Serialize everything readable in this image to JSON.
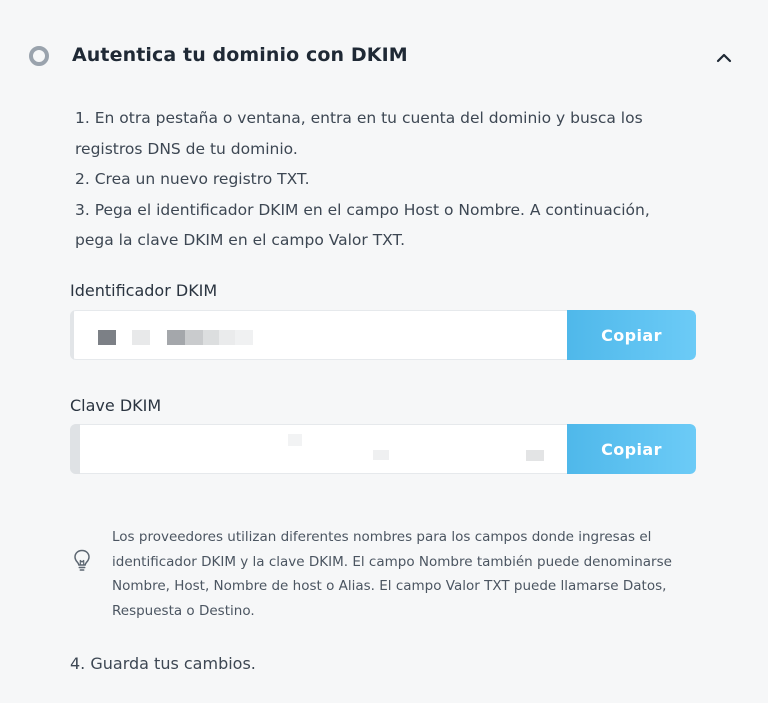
{
  "header": {
    "title": "Autentica tu dominio con DKIM"
  },
  "instructions": [
    "1. En otra pestaña o ventana, entra en tu cuenta del dominio y busca los",
    "registros DNS de tu dominio.",
    "2. Crea un nuevo registro TXT.",
    "3. Pega el identificador DKIM en el campo Host o Nombre. A continuación,",
    "pega la clave DKIM en el campo Valor TXT."
  ],
  "dkim_identifier": {
    "label": "Identificador DKIM",
    "value": "",
    "copy_label": "Copiar"
  },
  "dkim_key": {
    "label": "Clave DKIM",
    "value": "",
    "copy_label": "Copiar"
  },
  "tip": {
    "lines": [
      "Los proveedores utilizan diferentes nombres para los campos donde ingresas el",
      "identificador DKIM y la clave DKIM. El campo Nombre también puede denominarse",
      "Nombre, Host, Nombre de host o Alias. El campo Valor TXT puede llamarse Datos,",
      "Respuesta o Destino."
    ],
    "icon": "lightbulb-icon"
  },
  "step4": "4. Guarda tus cambios.",
  "colors": {
    "accent": "#5bc0f0",
    "background": "#f6f7f8",
    "text": "#232f3e"
  }
}
